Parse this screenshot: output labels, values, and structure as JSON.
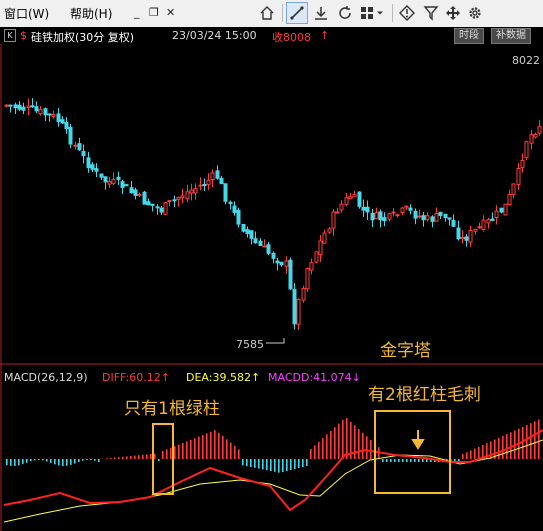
{
  "menu": {
    "window": "窗口(W)",
    "help": "帮助(H)",
    "minimize": "_",
    "restore": "❐",
    "close": "✕"
  },
  "toolbar": {
    "icons": [
      "home-icon",
      "draw-line-icon",
      "download-icon",
      "refresh-icon",
      "grid-icon",
      "dropdown-arrow-icon",
      "diamond-icon",
      "filter-icon",
      "move-icon",
      "gear-icon"
    ]
  },
  "header": {
    "k_label": "K",
    "dollar": "$",
    "title": "硅铁加权(30分 复权)",
    "date": "23/03/24 15:00",
    "close_label": "收8008",
    "up_arrow": "↑",
    "btn_timeseg": "时段",
    "btn_fill": "补数据"
  },
  "price_axis": {
    "top_label": "8022",
    "low_label": "7585"
  },
  "annotations": {
    "pyramid": "金字塔",
    "one_green": "只有1根绿柱",
    "two_red": "有2根红柱毛刺"
  },
  "macd": {
    "name": "MACD(26,12,9)",
    "diff": "DIFF:60.12↑",
    "dea": "DEA:39.582↑",
    "macdd": "MACDD:41.074↓"
  },
  "colors": {
    "up": "#ff3b3b",
    "down": "#44d8e8",
    "diff_line": "#ff2020",
    "dea_line": "#ffff40",
    "annot": "#f5b830"
  }
}
